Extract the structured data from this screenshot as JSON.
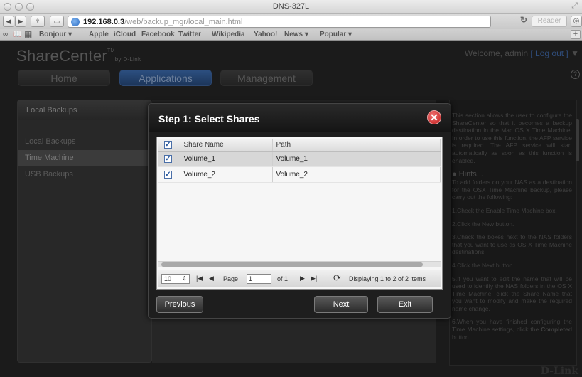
{
  "browser": {
    "window_title": "DNS-327L",
    "url_host": "192.168.0.3",
    "url_path": "/web/backup_mgr/local_main.html",
    "reader_label": "Reader",
    "bookmarks": [
      "Bonjour ▾",
      "Apple",
      "iCloud",
      "Facebook",
      "Twitter",
      "Wikipedia",
      "Yahoo!",
      "News ▾",
      "Popular ▾"
    ]
  },
  "app": {
    "logo": "ShareCenter",
    "logo_tm": "TM",
    "logo_by": "by D-Link",
    "welcome_prefix": "Welcome, admin",
    "logout_label": "[ Log out ]",
    "welcome_arrow": "▼",
    "help_glyph": "?",
    "nav": [
      "Home",
      "Applications",
      "Management"
    ]
  },
  "sidebar": {
    "header": "Local Backups",
    "items": [
      "Local Backups",
      "Time Machine",
      "USB Backups"
    ],
    "selected": "Time Machine"
  },
  "modal": {
    "title": "Step 1: Select Shares",
    "close_glyph": "✕",
    "columns": [
      "Share Name",
      "Path"
    ],
    "rows": [
      {
        "checked": "✓",
        "name": "Volume_1",
        "path": "Volume_1"
      },
      {
        "checked": "✓",
        "name": "Volume_2",
        "path": "Volume_2"
      }
    ],
    "header_checked": "✓",
    "pager": {
      "page_size": "10",
      "page_label": "Page",
      "page_value": "1",
      "of_label": "of 1",
      "displaying": "Displaying 1 to 2 of 2 items"
    },
    "buttons": {
      "previous": "Previous",
      "next": "Next",
      "exit": "Exit"
    }
  },
  "help": {
    "intro": "This section allows the user to configure the ShareCenter so that it becomes a backup destination in the Mac OS X Time Machine. In order to use this function, the AFP service is required. The AFP service will start automatically as soon as this function is enabled.",
    "hints_title": "Hints...",
    "hints_intro": "To add folders on your NAS as a destination for the OSX Time Machine backup, please carry out the following:",
    "steps": [
      "1.Check the Enable Time Machine box.",
      "2.Click the New button.",
      "3.Check the boxes next to the NAS folders that you want to use as OS X Time Machine destinations.",
      "4.Click the Next button.",
      "5.If you want to edit the name that will be used to identify the NAS folders in the OS X Time Machine, click the Share Name that you want to modify and make the required name change."
    ],
    "step6_prefix": "6.When you have finished configuring the Time Machine settings, click the",
    "step6_bold": "Completed",
    "step6_suffix": "button.",
    "brand": "D-Link"
  },
  "colors": {
    "accent_blue": "#2c4f80",
    "close_red": "#c11d1d"
  }
}
